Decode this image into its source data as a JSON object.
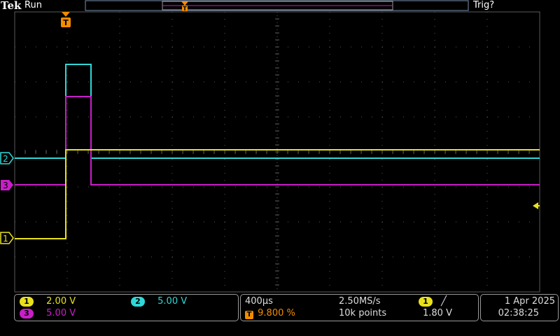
{
  "header": {
    "brand": "Tek",
    "run_state": "Run",
    "trigger_status": "Trig?"
  },
  "channels": [
    {
      "id": "1",
      "label": "1",
      "scale": "2.00 V",
      "color": "#e9e21b"
    },
    {
      "id": "2",
      "label": "2",
      "scale": "5.00 V",
      "color": "#2fd8d8"
    },
    {
      "id": "3",
      "label": "3",
      "scale": "5.00 V",
      "color": "#c81fc8"
    }
  ],
  "timebase": {
    "time_per_div": "400µs",
    "sample_rate": "2.50MS/s",
    "trigger_position": "9.800 %",
    "record_length": "10k points"
  },
  "trigger": {
    "source": "1",
    "slope_symbol": "╱",
    "level": "1.80 V",
    "marker_icon": "T",
    "level_arrow_icon": "left-arrow"
  },
  "clock": {
    "date": "1 Apr 2025",
    "time": "02:38:25"
  },
  "colors": {
    "graticule": "#5a5a5a",
    "trigger_orange": "#f28c00",
    "background": "#000000"
  }
}
